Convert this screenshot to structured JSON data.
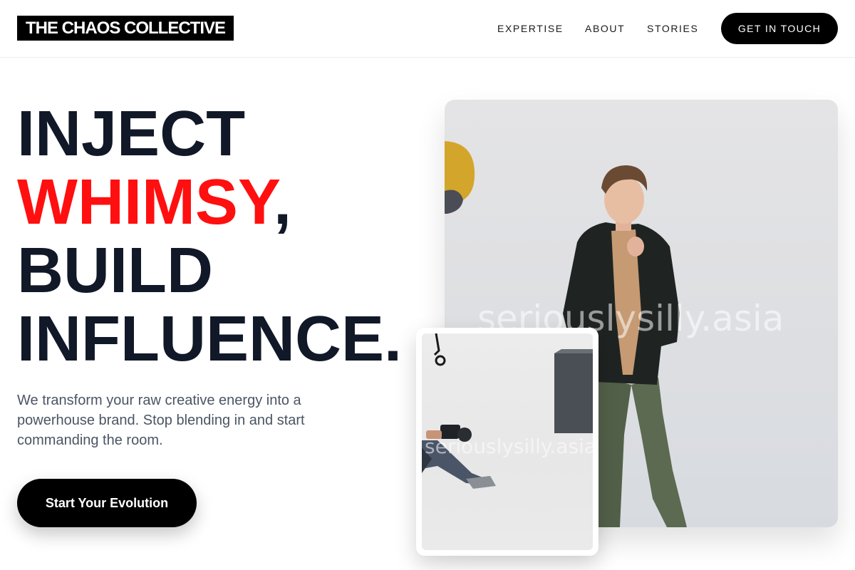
{
  "header": {
    "logo": "THE CHAOS COLLECTIVE",
    "nav": {
      "expertise": "EXPERTISE",
      "about": "ABOUT",
      "stories": "STORIES"
    },
    "cta": "GET IN TOUCH"
  },
  "hero": {
    "headline": {
      "line1": "INJECT",
      "accent_word": "WHIMSY",
      "comma": ",",
      "line3": "BUILD",
      "line4": "INFLUENCE."
    },
    "subtext": "We transform your raw creative energy into a powerhouse brand. Stop blending in and start commanding the room.",
    "primary_button": "Start Your Evolution",
    "main_image_watermark": "seriouslysilly.asia",
    "inset_image_watermark": "seriouslysilly.asia"
  },
  "colors": {
    "accent": "#ff0f0f",
    "text_dark": "#111827",
    "text_muted": "#4b5563",
    "button": "#000000"
  }
}
